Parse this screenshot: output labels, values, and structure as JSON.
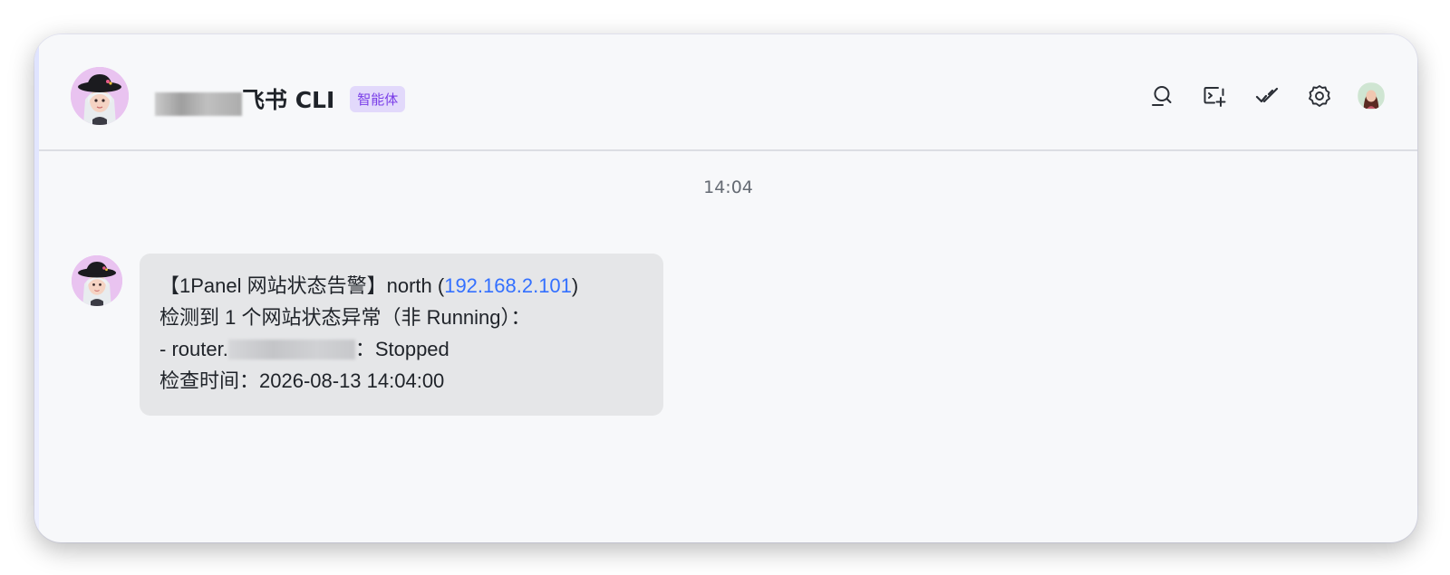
{
  "header": {
    "title": "飞书 CLI",
    "badge": "智能体",
    "toolbar": [
      {
        "icon": "search-icon"
      },
      {
        "icon": "add-screen-icon"
      },
      {
        "icon": "double-check-icon"
      },
      {
        "icon": "gear-icon"
      },
      {
        "icon": "user-avatar-icon"
      }
    ]
  },
  "chat": {
    "timestamp": "14:04",
    "message": {
      "line1_prefix": "【1Panel 网站状态告警】north (",
      "line1_ip": "192.168.2.101",
      "line1_suffix": ")",
      "line2": "检测到 1 个网站状态异常（非 Running）：",
      "line3_prefix": "- router.",
      "line3_suffix": "：Stopped",
      "line4": "检查时间：2026-08-13 14:04:00"
    }
  },
  "colors": {
    "accent_link": "#3370ff",
    "badge_bg": "#e2d9fb",
    "badge_text": "#7a3ee8",
    "bubble_bg": "#e5e6e8",
    "window_bg": "#f7f8fa"
  }
}
